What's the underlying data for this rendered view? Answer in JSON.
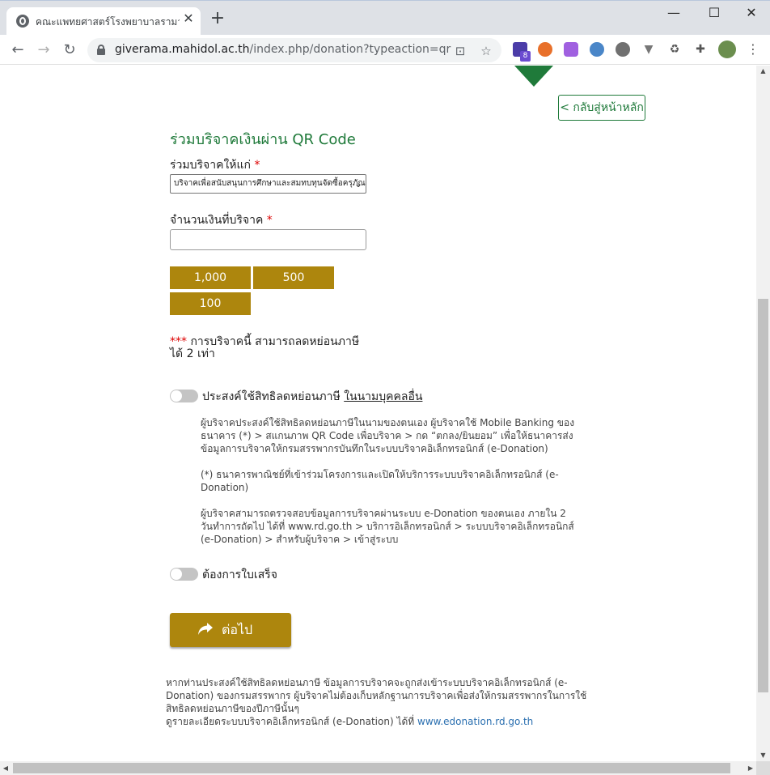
{
  "browser": {
    "tab_title": "คณะแพทยศาสตร์โรงพยาบาลรามาธิบดี",
    "tab_close": "✕",
    "new_tab": "+",
    "url_host": "giverama.mahidol.ac.th",
    "url_path": "/index.php/donation?typeaction=qr",
    "extension_badge": "8",
    "window": {
      "minimize": "—",
      "maximize": "☐",
      "close": "✕"
    }
  },
  "page": {
    "back_button": "< กลับสู่หน้าหลัก",
    "title": "ร่วมบริจาคเงินผ่าน QR Code",
    "donate_to_label": "ร่วมบริจาคให้แก่",
    "required_mark": "*",
    "donate_to_selected": "บริจาคเพื่อสนับสนุนการศึกษาและสมทบทุนจัดซื้อครุภัณฑ์",
    "amount_label": "จำนวนเงินที่บริจาค",
    "amount_value": "",
    "quick_amounts": [
      "1,000",
      "500",
      "100"
    ],
    "note_stars": "***",
    "note_text": " การบริจาคนี้ สามารถลดหย่อนภาษี ได้ 2 เท่า",
    "toggle1_label": "ประสงค์ใช้สิทธิลดหย่อนภาษี ",
    "toggle1_link": "ในนามบุคคลอื่น",
    "toggle1_on": false,
    "info1": "ผู้บริจาคประสงค์ใช้สิทธิลดหย่อนภาษีในนามของตนเอง ผู้บริจาคใช้ Mobile Banking ของธนาคาร (*) > สแกนภาพ QR Code เพื่อบริจาค > กด “ตกลง/ยินยอม” เพื่อให้ธนาคารส่งข้อมูลการบริจาคให้กรมสรรพากรบันทึกในระบบบริจาคอิเล็กทรอนิกส์ (e-Donation)",
    "info2": "(*) ธนาคารพาณิชย์ที่เข้าร่วมโครงการและเปิดให้บริการระบบบริจาคอิเล็กทรอนิกส์ (e-Donation)",
    "info3": "ผู้บริจาคสามารถตรวจสอบข้อมูลการบริจาคผ่านระบบ e-Donation ของตนเอง ภายใน 2 วันทำการถัดไป ได้ที่ www.rd.go.th > บริการอิเล็กทรอนิกส์ > ระบบบริจาคอิเล็กทรอนิกส์ (e-Donation) > สำหรับผู้บริจาค > เข้าสู่ระบบ",
    "toggle2_label": "ต้องการใบเสร็จ",
    "toggle2_on": false,
    "next_button": "ต่อไป",
    "footer_text": "หากท่านประสงค์ใช้สิทธิลดหย่อนภาษี ข้อมูลการบริจาคจะถูกส่งเข้าระบบบริจาคอิเล็กทรอนิกส์ (e-Donation) ของกรมสรรพากร ผู้บริจาคไม่ต้องเก็บหลักฐานการบริจาคเพื่อส่งให้กรมสรรพากรในการใช้สิทธิลดหย่อนภาษีของปีภาษีนั้นๆ",
    "footer_more": "ดูรายละเอียดระบบบริจาคอิเล็กทรอนิกส์ (e-Donation) ได้ที่ ",
    "footer_link": "www.edonation.rd.go.th"
  },
  "colors": {
    "brand_green": "#1f7a3a",
    "gold": "#ad860d",
    "required_red": "#dd0000"
  }
}
